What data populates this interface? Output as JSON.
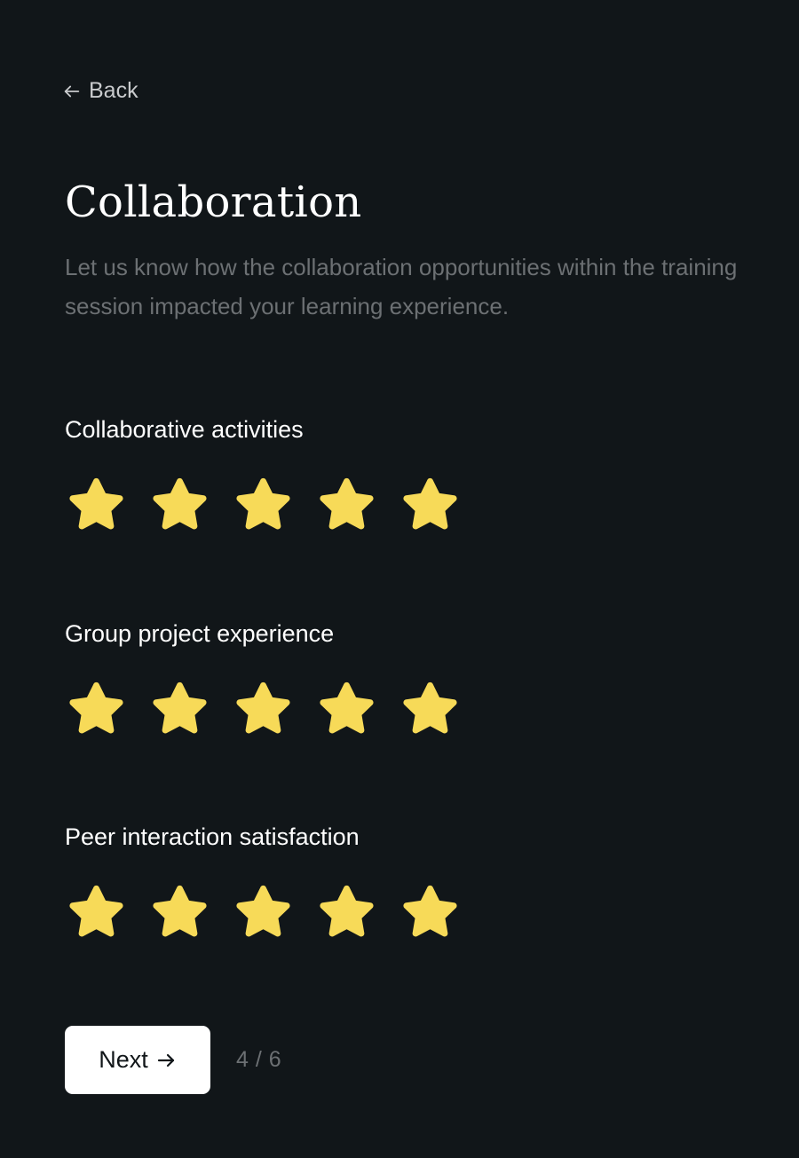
{
  "nav": {
    "back_label": "Back",
    "back_icon": "arrow-left-icon"
  },
  "header": {
    "title": "Collaboration",
    "subtitle": "Let us know how the collaboration opportunities within the training session impacted your learning experience."
  },
  "ratings": [
    {
      "label": "Collaborative activities",
      "value": 5,
      "max": 5
    },
    {
      "label": "Group project experience",
      "value": 5,
      "max": 5
    },
    {
      "label": "Peer interaction satisfaction",
      "value": 5,
      "max": 5
    }
  ],
  "footer": {
    "next_label": "Next",
    "next_icon": "arrow-right-icon",
    "progress": "4 / 6",
    "current_step": 4,
    "total_steps": 6
  },
  "colors": {
    "background": "#111619",
    "star_filled": "#f7da58",
    "star_empty": "#3a3f43",
    "muted_text": "#6c7073",
    "button_bg": "#ffffff"
  }
}
